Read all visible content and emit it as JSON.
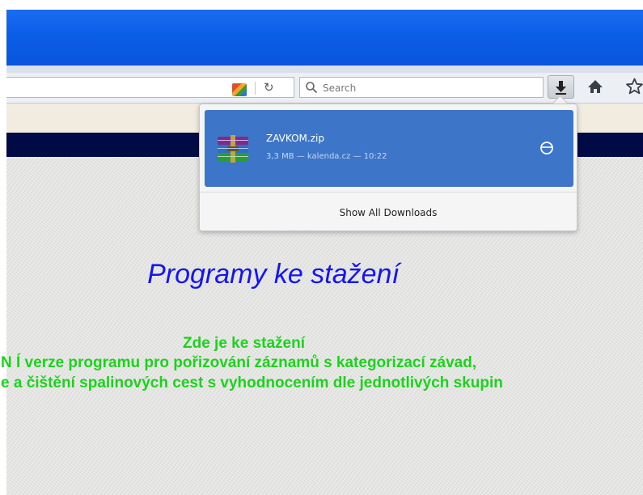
{
  "toolbar": {
    "search_placeholder": "Search",
    "icons": [
      "avast-icon",
      "reload-icon",
      "search-icon",
      "downloads-icon",
      "home-icon",
      "bookmark-star-icon"
    ]
  },
  "downloads_panel": {
    "items": [
      {
        "file_name": "ZAVKOM.zip",
        "meta": "3,3 MB — kalenda.cz — 10:22",
        "icon": "winrar-archive-icon"
      }
    ],
    "show_all_label": "Show All Downloads"
  },
  "page": {
    "title": "Programy ke stažení",
    "line1": "Zde je ke stažení",
    "line2": "N Í verze    programu pro pořizování záznamů s kategorizací závad,",
    "line3": "e a čištění spalinových cest s vyhodnocením dle jednotlivých skupin"
  },
  "colors": {
    "titlebar": "#0b5ee8",
    "page_topbar": "#000b46",
    "download_item_bg": "#3d76c8",
    "title_text": "#1515f0",
    "green_text": "#1dd21d"
  }
}
